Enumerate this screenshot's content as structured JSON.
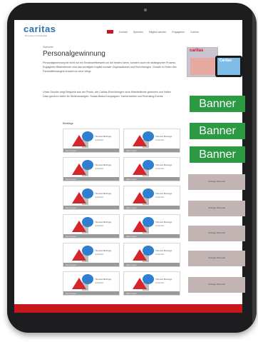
{
  "header": {
    "logo": "caritas",
    "logo_tagline": "Not sehen und handeln",
    "nav_items": [
      "Kontakt",
      "Spenden",
      "Mitglied werden",
      "Engagieren",
      "Suchen"
    ]
  },
  "main": {
    "breadcrumb": "Startseite",
    "title": "Personalgewinnung",
    "paragraphs": [
      "Personalgewinnung ist nicht nur ein Kreativwettbewerb um die besten Ideen, sondern auch ein strategischer Prozess. Engagierte Mitarbeitende sind das wichtigste Kapital sozialer Organisationen und Einrichtungen. Gerade in Zeiten des Fachkräftemangels braucht es neue Wege.",
      "Unser Dossier zeigt Beispiele aus der Praxis, wie Caritas-Einrichtungen neue Mitarbeitende gewinnen und halten. Dazu gehören Ideen für Stellenanzeigen, Social-Media-Kampagnen, Karriereseiten und Recruiting-Events."
    ],
    "section_label": "Beiträge"
  },
  "cards": [
    {
      "title": "Titel des Beitrags",
      "subtitle": "Untertitel",
      "footer": "Mehr lesen"
    },
    {
      "title": "Titel des Beitrags",
      "subtitle": "Untertitel",
      "footer": "Mehr lesen"
    },
    {
      "title": "Titel des Beitrags",
      "subtitle": "Untertitel",
      "footer": "Mehr lesen"
    },
    {
      "title": "Titel des Beitrags",
      "subtitle": "Untertitel",
      "footer": "Mehr lesen"
    },
    {
      "title": "Titel des Beitrags",
      "subtitle": "Untertitel",
      "footer": "Mehr lesen"
    },
    {
      "title": "Titel des Beitrags",
      "subtitle": "Untertitel",
      "footer": "Mehr lesen"
    },
    {
      "title": "Titel des Beitrags",
      "subtitle": "Untertitel",
      "footer": "Mehr lesen"
    },
    {
      "title": "Titel des Beitrags",
      "subtitle": "Untertitel",
      "footer": "Mehr lesen"
    },
    {
      "title": "Titel des Beitrags",
      "subtitle": "Untertitel",
      "footer": "Mehr lesen"
    },
    {
      "title": "Titel des Beitrags",
      "subtitle": "Untertitel",
      "footer": "Mehr lesen"
    },
    {
      "title": "Titel des Beitrags",
      "subtitle": "Untertitel",
      "footer": "Mehr lesen"
    },
    {
      "title": "Titel des Beitrags",
      "subtitle": "Untertitel",
      "footer": "Mehr lesen"
    }
  ],
  "sidebar": {
    "magazine_title": "caritas",
    "magazine_tablet_title": "Caritas",
    "banners": [
      "Banner",
      "Banner",
      "Banner"
    ],
    "ads": [
      "Anzeige Personal",
      "Anzeige Personal",
      "Anzeige Personal",
      "Anzeige Personal",
      "Anzeige Personal"
    ]
  },
  "colors": {
    "brand": "#2b6fa8",
    "accent_red": "#c8161d",
    "banner_green": "#2b9a43",
    "ad_background": "#c2b4b2"
  }
}
